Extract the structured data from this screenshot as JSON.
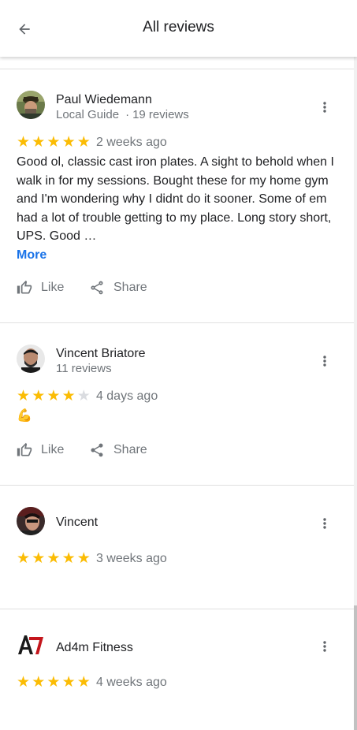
{
  "header": {
    "title": "All reviews"
  },
  "colors": {
    "star": "#fbbc04",
    "star_off": "#dadce0",
    "link": "#1a73e8",
    "muted": "#70757a"
  },
  "reviews": [
    {
      "name": "Paul Wiedemann",
      "badge": "Local Guide",
      "count": "19 reviews",
      "stars": 5,
      "ago": "2 weeks ago",
      "text": "Good ol, classic cast iron plates. A sight to behold when I walk in for my sessions. Bought these for my home gym and I'm wondering why I didnt do it sooner. Some of em had a lot of trouble getting to my place. Long story short, UPS. Good …",
      "more": "More",
      "like": "Like",
      "share": "Share"
    },
    {
      "name": "Vincent Briatore",
      "count": "11 reviews",
      "stars": 4,
      "ago": "4 days ago",
      "text": "💪",
      "like": "Like",
      "share": "Share"
    },
    {
      "name": "Vincent",
      "stars": 5,
      "ago": "3 weeks ago"
    },
    {
      "name": "Ad4m Fitness",
      "stars": 5,
      "ago": "4 weeks ago"
    }
  ]
}
